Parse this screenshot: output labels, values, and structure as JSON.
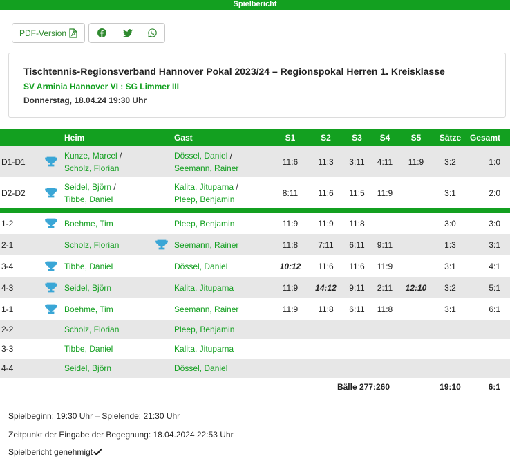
{
  "header": {
    "title": "Spielbericht"
  },
  "toolbar": {
    "pdf_label": "PDF-Version",
    "share": [
      "facebook-icon",
      "twitter-icon",
      "whatsapp-icon"
    ]
  },
  "info": {
    "title": "Tischtennis-Regionsverband Hannover Pokal 2023/24 – Regionspokal Herren 1. Kreisklasse",
    "teams": "SV Arminia Hannover VI : SG Limmer III",
    "date": "Donnerstag, 18.04.24 19:30 Uhr"
  },
  "table": {
    "headers": {
      "heim": "Heim",
      "gast": "Gast",
      "s1": "S1",
      "s2": "S2",
      "s3": "S3",
      "s4": "S4",
      "s5": "S5",
      "saetze": "Sätze",
      "gesamt": "Gesamt"
    },
    "doubles": [
      {
        "code": "D1-D1",
        "heim1": "Kunze, Marcel",
        "heim2": "Scholz, Florian",
        "gast1": "Dössel, Daniel",
        "gast2": "Seemann, Rainer",
        "s1": "11:6",
        "s2": "11:3",
        "s3": "3:11",
        "s4": "4:11",
        "s5": "11:9",
        "saetze": "3:2",
        "gesamt": "1:0"
      },
      {
        "code": "D2-D2",
        "heim1": "Seidel, Björn",
        "heim2": "Tibbe, Daniel",
        "gast1": "Kalita, Jituparna",
        "gast2": "Pleep, Benjamin",
        "s1": "8:11",
        "s2": "11:6",
        "s3": "11:5",
        "s4": "11:9",
        "s5": "",
        "saetze": "3:1",
        "gesamt": "2:0"
      }
    ],
    "singles": [
      {
        "code": "1-2",
        "heim": "Boehme, Tim",
        "gast": "Pleep, Benjamin",
        "s1": "11:9",
        "s2": "11:9",
        "s3": "11:8",
        "s4": "",
        "s5": "",
        "saetze": "3:0",
        "gesamt": "3:0"
      },
      {
        "code": "2-1",
        "heim": "Scholz, Florian",
        "gast": "Seemann, Rainer",
        "s1": "11:8",
        "s2": "7:11",
        "s3": "6:11",
        "s4": "9:11",
        "s5": "",
        "saetze": "1:3",
        "gesamt": "3:1"
      },
      {
        "code": "3-4",
        "heim": "Tibbe, Daniel",
        "gast": "Dössel, Daniel",
        "s1": "10:12",
        "s2": "11:6",
        "s3": "11:6",
        "s4": "11:9",
        "s5": "",
        "saetze": "3:1",
        "gesamt": "4:1"
      },
      {
        "code": "4-3",
        "heim": "Seidel, Björn",
        "gast": "Kalita, Jituparna",
        "s1": "11:9",
        "s2": "14:12",
        "s3": "9:11",
        "s4": "2:11",
        "s5": "12:10",
        "saetze": "3:2",
        "gesamt": "5:1"
      },
      {
        "code": "1-1",
        "heim": "Boehme, Tim",
        "gast": "Seemann, Rainer",
        "s1": "11:9",
        "s2": "11:8",
        "s3": "6:11",
        "s4": "11:8",
        "s5": "",
        "saetze": "3:1",
        "gesamt": "6:1"
      },
      {
        "code": "2-2",
        "heim": "Scholz, Florian",
        "gast": "Pleep, Benjamin"
      },
      {
        "code": "3-3",
        "heim": "Tibbe, Daniel",
        "gast": "Kalita, Jituparna"
      },
      {
        "code": "4-4",
        "heim": "Seidel, Björn",
        "gast": "Dössel, Daniel"
      }
    ],
    "totals": {
      "baelle": "Bälle 277:260",
      "saetze": "19:10",
      "gesamt": "6:1"
    }
  },
  "footer": {
    "times": "Spielbeginn: 19:30 Uhr – Spielende: 21:30 Uhr",
    "entry": "Zeitpunkt der Eingabe der Begegnung: 18.04.2024 22:53 Uhr",
    "approved": "Spielbericht genehmigt"
  },
  "colors": {
    "accent": "#13a020",
    "cup": "#3aa6d6",
    "row_alt": "#e7e7e7"
  }
}
